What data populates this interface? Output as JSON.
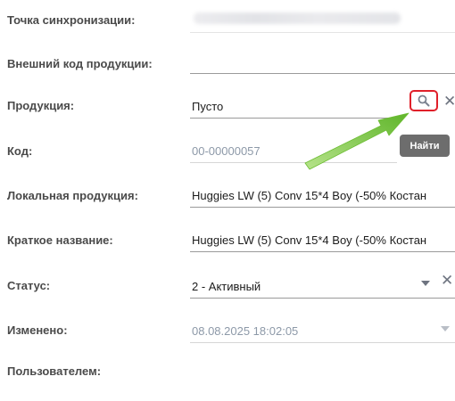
{
  "form": {
    "sync_point": {
      "label": "Точка синхронизации:"
    },
    "external_code": {
      "label": "Внешний код продукции:",
      "value": ""
    },
    "product": {
      "label": "Продукция:",
      "value": "Пусто"
    },
    "code": {
      "label": "Код:",
      "value": "00-00000057"
    },
    "local_product": {
      "label": "Локальная продукция:",
      "value": "Huggies  LW (5) Conv 15*4 Boy (-50% Костан"
    },
    "short_name": {
      "label": "Краткое название:",
      "value": "Huggies  LW (5) Conv 15*4 Boy (-50% Костан"
    },
    "status": {
      "label": "Статус:",
      "value": "2 - Активный"
    },
    "changed": {
      "label": "Изменено:",
      "value": "08.08.2025 18:02:05"
    },
    "by_user": {
      "label": "Пользователем:"
    }
  },
  "tooltip": {
    "text": "Найти"
  },
  "icons": {
    "search": "search-icon",
    "clear": "close-icon",
    "dropdown": "chevron-down-icon",
    "arrow": "arrow-annotation"
  },
  "colors": {
    "highlight_border": "#e0202a",
    "arrow_green": "#7cc83a",
    "tooltip_bg": "#6d6d6d"
  }
}
